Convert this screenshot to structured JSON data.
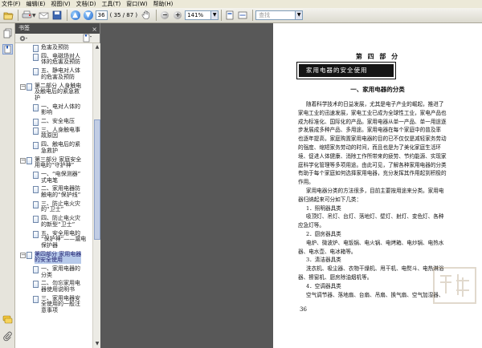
{
  "menu": [
    "文件(F)",
    "编辑(E)",
    "视图(V)",
    "文档(D)",
    "工具(T)",
    "窗口(W)",
    "帮助(H)"
  ],
  "toolbar": {
    "current_page": "36",
    "page_count": "( 35 / 87 )",
    "zoom": "141%",
    "search_placeholder": "查找"
  },
  "panel": {
    "title": "书签",
    "close": "×"
  },
  "bookmarks": [
    {
      "id": "b0",
      "kind": "page",
      "lines": [
        "危害及预防"
      ]
    },
    {
      "id": "b1",
      "kind": "page",
      "lines": [
        "四、电磁场对人",
        "体的危害及预防"
      ]
    },
    {
      "id": "b2",
      "kind": "page",
      "lines": [
        "五、静电对人体",
        "的危害及预防"
      ]
    },
    {
      "id": "b3",
      "kind": "part",
      "lines": [
        "第二部分 人身触电",
        "及触电后的紧急救",
        "护"
      ]
    },
    {
      "id": "b4",
      "kind": "page",
      "lines": [
        "一、电对人体的",
        "影响"
      ]
    },
    {
      "id": "b5",
      "kind": "page",
      "lines": [
        "二、安全电压"
      ]
    },
    {
      "id": "b6",
      "kind": "page",
      "lines": [
        "三、人身触电事",
        "故原因"
      ]
    },
    {
      "id": "b7",
      "kind": "page",
      "lines": [
        "四、触电后的紧",
        "急救护"
      ]
    },
    {
      "id": "b8",
      "kind": "part",
      "lines": [
        "第三部分 家庭安全",
        "用电的“守护神”"
      ]
    },
    {
      "id": "b9",
      "kind": "page",
      "lines": [
        "一、“电保测器”",
        "式电笔"
      ]
    },
    {
      "id": "b10",
      "kind": "page",
      "lines": [
        "二、家用电器防",
        "触电的“保护线”"
      ]
    },
    {
      "id": "b11",
      "kind": "page",
      "lines": [
        "三、防止电火灾",
        "的“卫士”"
      ]
    },
    {
      "id": "b12",
      "kind": "page",
      "lines": [
        "四、防止电火灾",
        "的新型“卫士”"
      ]
    },
    {
      "id": "b13",
      "kind": "page",
      "lines": [
        "五、安全用电的",
        "“保护神”——漏电",
        "保护器"
      ]
    },
    {
      "id": "b14",
      "kind": "part",
      "selected": true,
      "lines": [
        "第四部分 家用电器",
        "的安全使用"
      ]
    },
    {
      "id": "b15",
      "kind": "page",
      "lines": [
        "一、家用电器的",
        "分类"
      ]
    },
    {
      "id": "b16",
      "kind": "page",
      "lines": [
        "二、勿忘家用电",
        "器使用说明书"
      ]
    },
    {
      "id": "b17",
      "kind": "page",
      "lines": [
        "三、家用电器安",
        "全使用的一般注",
        "意事项"
      ]
    }
  ],
  "document": {
    "part_title": "第 四 部 分",
    "banner": "家用电器的安全使用",
    "section_title": "一、家用电器的分类",
    "body_lines": [
      "随着科学技术的日益发展，尤其是电子产业的崛起，推进了",
      "家电工业的迅速发展，家电工业已成为全球性工业，家电产品也",
      "成为标准化、国际化的产品。家用电器从单一产品、单一用途逐",
      "步发展成多种产品、多用途。家用电器在每个家庭中的普及率",
      "也逐年提高，家庭购置家用电器的目的已不仅仅是减轻家务劳动",
      "的强度、缩短家务劳动的时间，而且也是为了美化家庭生活环",
      "境、促进人体健康、消除工作所带来的疲劳、节约能源、实现家",
      "庭科学化管理等多项用途。由此可见，了解各种家用电器的分类",
      "有助于每个家庭如何选择家用电器，充分发挥其作用起到积极的",
      "作用。",
      "家用电器分类的方法很多，目前主要按用途来分类。家用电",
      "器归纳起来可分如下几类：",
      "1．照明器具类",
      "吸顶灯、吊灯、台灯、落地灯、壁灯、射灯、变色灯、各种",
      "应急灯等。",
      "2．厨房器具类",
      "电炉、微波炉、电饭锅、电火锅、电烤箱、电炒锅、电热水",
      "器、电水壶、电冰箱等。",
      "3．清洁器具类",
      "洗衣机、吸尘器、衣物干燥机、甩干机、电熨斗、电热淋浴",
      "器、擦窗机、厨房除油烟机等。",
      "4．空调器具类",
      "空气调节器、落地扇、台扇、吊扇、换气扇、空气加湿器、"
    ],
    "page_number": "36"
  },
  "colors": {
    "menu_bg": "#ece9d8",
    "panel_header": "#4b4b4b",
    "selection": "#b6c9ea",
    "doc_background": "#585858",
    "banner": "#151515"
  },
  "icons": {
    "rail": [
      "pages-icon",
      "bookmarks-icon",
      "comments-icon",
      "attachments-icon"
    ],
    "toolbar": [
      "open-icon",
      "print-icon",
      "email-icon",
      "save-icon",
      "prev-page-icon",
      "next-page-icon",
      "zoom-out-icon",
      "zoom-in-icon",
      "fit-page-icon",
      "fit-width-icon",
      "search-icon"
    ]
  }
}
